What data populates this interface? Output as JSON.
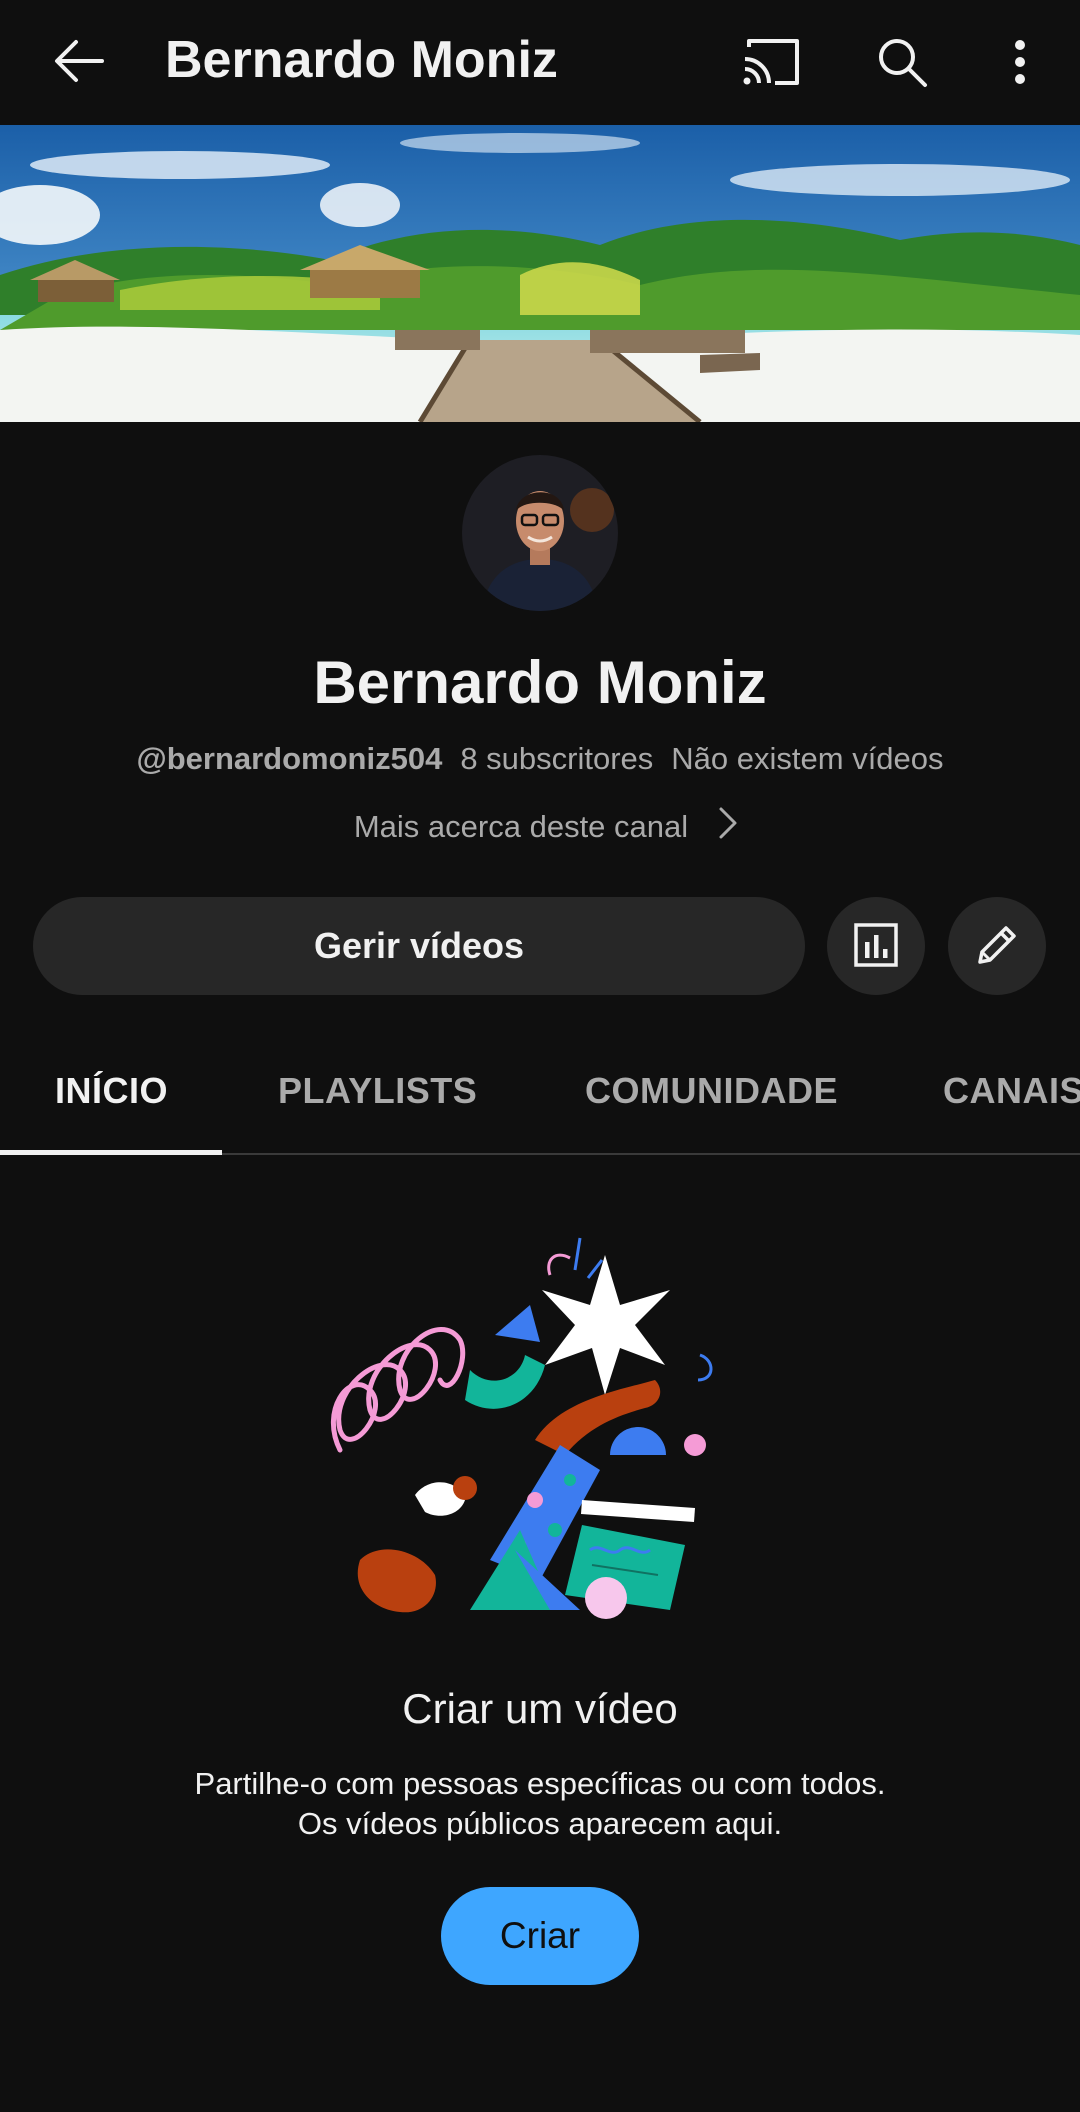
{
  "appbar": {
    "title": "Bernardo Moniz",
    "icons": [
      "back-arrow-icon",
      "cast-icon",
      "search-icon",
      "more-vert-icon"
    ]
  },
  "channel": {
    "name": "Bernardo Moniz",
    "handle": "@bernardomoniz504",
    "subscribers": "8 subscritores",
    "videos": "Não existem vídeos",
    "about_label": "Mais acerca deste canal"
  },
  "actions": {
    "manage_label": "Gerir vídeos",
    "stats_icon": "analytics-icon",
    "edit_icon": "pencil-icon"
  },
  "tabs": [
    {
      "label": "INÍCIO",
      "active": true
    },
    {
      "label": "PLAYLISTS",
      "active": false
    },
    {
      "label": "COMUNIDADE",
      "active": false
    },
    {
      "label": "CANAIS",
      "active": false
    }
  ],
  "empty_state": {
    "title": "Criar um vídeo",
    "desc_line1": "Partilhe-o com pessoas específicas ou com todos.",
    "desc_line2": "Os vídeos públicos aparecem aqui.",
    "create_label": "Criar"
  },
  "colors": {
    "background": "#0f0f0f",
    "surface": "#272727",
    "accent": "#3ea6ff",
    "text_primary": "#f1f1f1",
    "text_secondary": "#aaaaaa"
  }
}
